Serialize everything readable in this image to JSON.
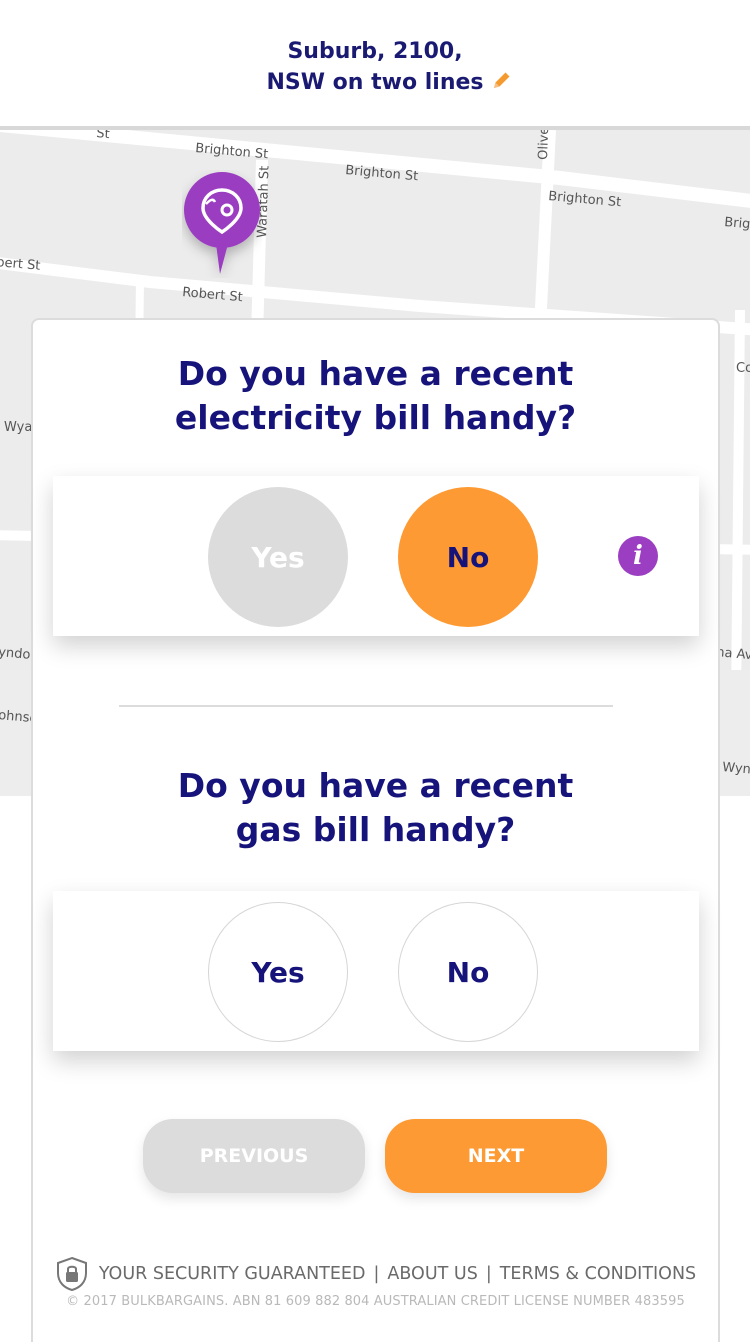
{
  "header": {
    "address_line1": "Suburb, 2100,",
    "address_line2": "NSW on two lines",
    "edit_icon": "pencil-icon",
    "accent_color": "#fe9a33"
  },
  "map": {
    "streets": [
      "Brighton St",
      "Brighton St",
      "Brighton St",
      "Brig",
      "Robert St",
      "bert St",
      "Waratah St",
      "Olive",
      "Wya",
      "yndo",
      "ohnsc",
      "na Av",
      "Wyn",
      "Co",
      "St"
    ],
    "pin_icon": "location-pin-icon",
    "pin_color": "#9b3ec1"
  },
  "question1": {
    "text": "Do you have a recent electricity bill handy?",
    "yes_label": "Yes",
    "no_label": "No",
    "selected": "No",
    "info_label": "i"
  },
  "question2": {
    "text": "Do you have a recent gas bill handy?",
    "yes_label": "Yes",
    "no_label": "No",
    "selected": ""
  },
  "nav": {
    "previous_label": "PREVIOUS",
    "next_label": "NEXT"
  },
  "footer": {
    "security_label": "YOUR SECURITY GUARANTEED",
    "separator": "|",
    "about_label": "ABOUT US",
    "terms_label": "TERMS & CONDITIONS",
    "copyright": "© 2017 BULKBARGAINS. ABN 81 609 882 804 AUSTRALIAN CREDIT LICENSE NUMBER 483595"
  }
}
